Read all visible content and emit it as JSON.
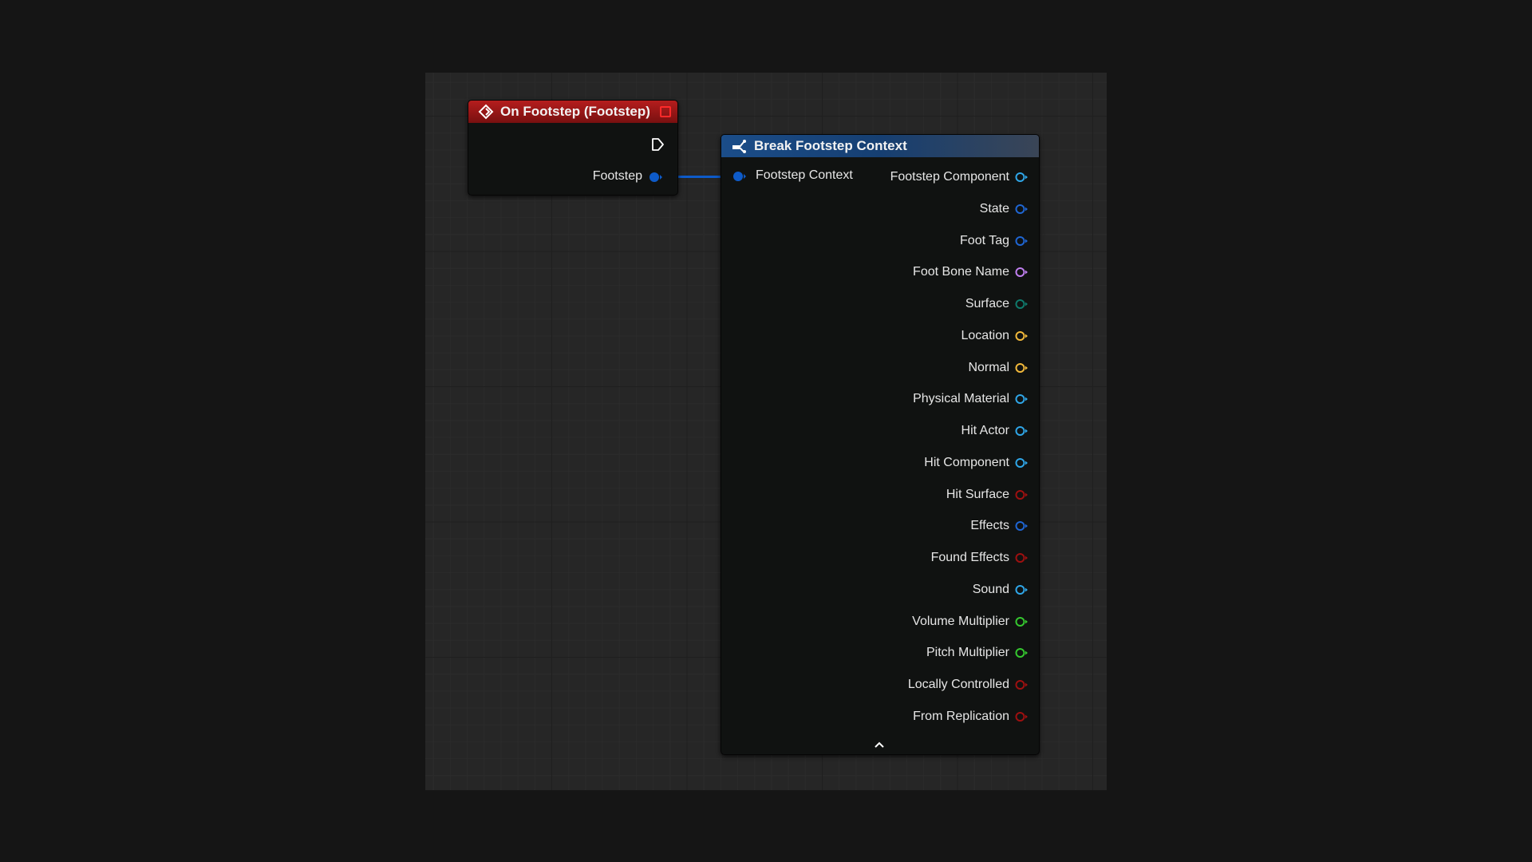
{
  "event_node": {
    "title": "On Footstep (Footstep)",
    "output_label": "Footstep",
    "colors": {
      "header": "#b51d1d",
      "delegate": "#ff2a2a",
      "pin": "#0e5bc9"
    }
  },
  "break_node": {
    "title": "Break Footstep Context",
    "input_label": "Footstep Context",
    "outputs": [
      {
        "label": "Footstep Component",
        "color": "#2fa6e8"
      },
      {
        "label": "State",
        "color": "#1f66d4"
      },
      {
        "label": "Foot Tag",
        "color": "#1f66d4"
      },
      {
        "label": "Foot Bone Name",
        "color": "#c07ff0"
      },
      {
        "label": "Surface",
        "color": "#0f7a6c"
      },
      {
        "label": "Location",
        "color": "#f2b93b"
      },
      {
        "label": "Normal",
        "color": "#f2b93b"
      },
      {
        "label": "Physical Material",
        "color": "#2fa6e8"
      },
      {
        "label": "Hit Actor",
        "color": "#2fa6e8"
      },
      {
        "label": "Hit Component",
        "color": "#2fa6e8"
      },
      {
        "label": "Hit Surface",
        "color": "#9e1010"
      },
      {
        "label": "Effects",
        "color": "#1f66d4"
      },
      {
        "label": "Found Effects",
        "color": "#9e1010"
      },
      {
        "label": "Sound",
        "color": "#2fa6e8"
      },
      {
        "label": "Volume Multiplier",
        "color": "#35c82f"
      },
      {
        "label": "Pitch Multiplier",
        "color": "#35c82f"
      },
      {
        "label": "Locally Controlled",
        "color": "#9e1010"
      },
      {
        "label": "From Replication",
        "color": "#9e1010"
      }
    ],
    "colors": {
      "header": "#1b4d89",
      "input_pin": "#0e5bc9"
    }
  }
}
